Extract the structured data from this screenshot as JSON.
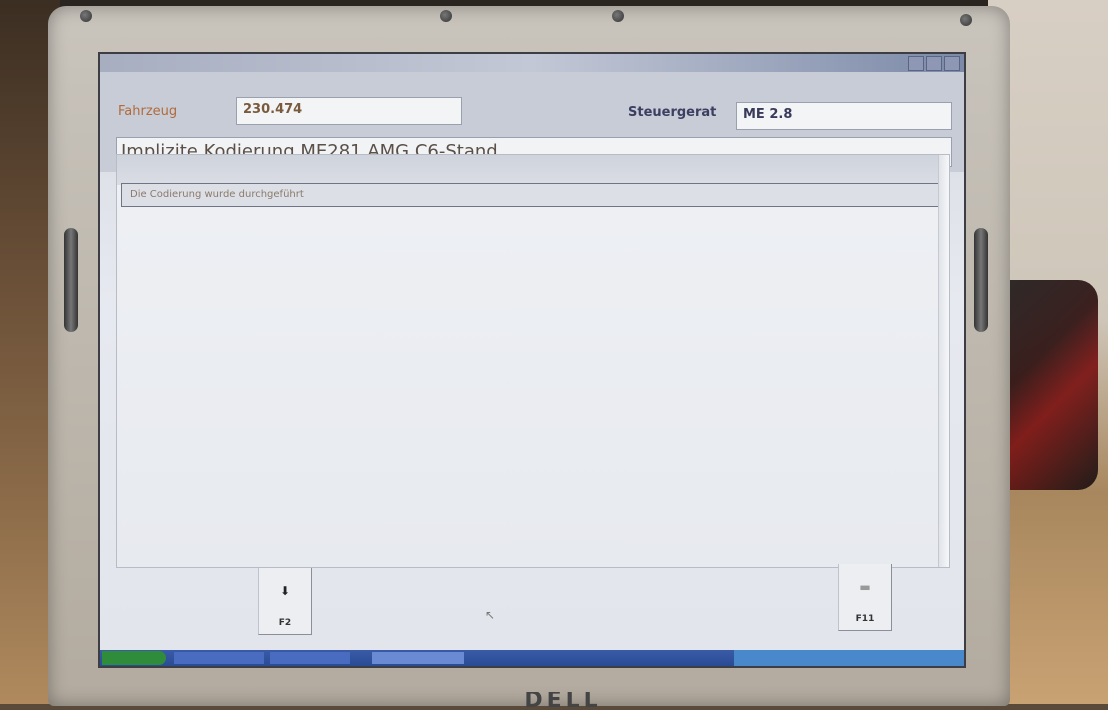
{
  "window": {
    "title": ""
  },
  "header": {
    "vehicle_label": "Fahrzeug",
    "vehicle_value": "230.474",
    "ecu_label": "Steuergerat",
    "ecu_value": "ME 2.8",
    "title": "Implizite Kodierung ME281 AMG C6-Stand"
  },
  "content": {
    "message": "Die Codierung wurde durchgeführt"
  },
  "fkeys": [
    {
      "label": "F2",
      "icon": "arrow-down-icon"
    },
    {
      "label": "F11",
      "icon": "printer-icon"
    }
  ],
  "taskbar": {
    "start_label": "",
    "items": [
      "",
      "",
      ""
    ]
  },
  "device": {
    "brand": "DELL"
  },
  "colors": {
    "vehicle_label": "#b06a3b",
    "ecu_label": "#3c3e62",
    "taskbar": "#2a4c94"
  }
}
